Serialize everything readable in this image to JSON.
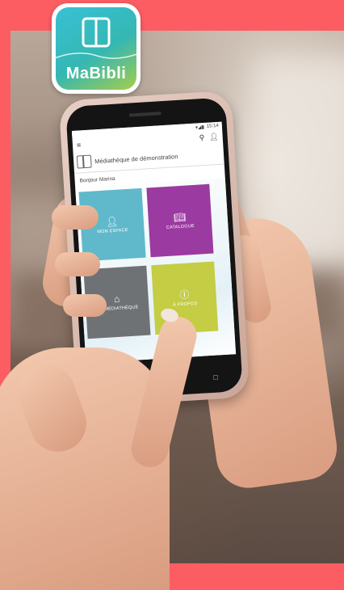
{
  "logo": {
    "text": "MaBibli",
    "icon": "open-book-icon"
  },
  "phone": {
    "status_time": "15:14",
    "library_name": "Médiathèque de démonstration",
    "greeting": "Bonjour Marina",
    "tiles": [
      {
        "label": "MON ESPACE",
        "icon": "person-icon",
        "color": "#5fb9cb"
      },
      {
        "label": "CATALOGUE",
        "icon": "book-icon",
        "color": "#9b3aa0"
      },
      {
        "label": "MA MÉDIATHÈQUE",
        "icon": "home-icon",
        "color": "#6f7275"
      },
      {
        "label": "À PROPOS",
        "icon": "info-icon",
        "color": "#c4cd44"
      }
    ],
    "nav": [
      "◁",
      "○",
      "□"
    ]
  },
  "colors": {
    "frame": "#fb5d63"
  }
}
